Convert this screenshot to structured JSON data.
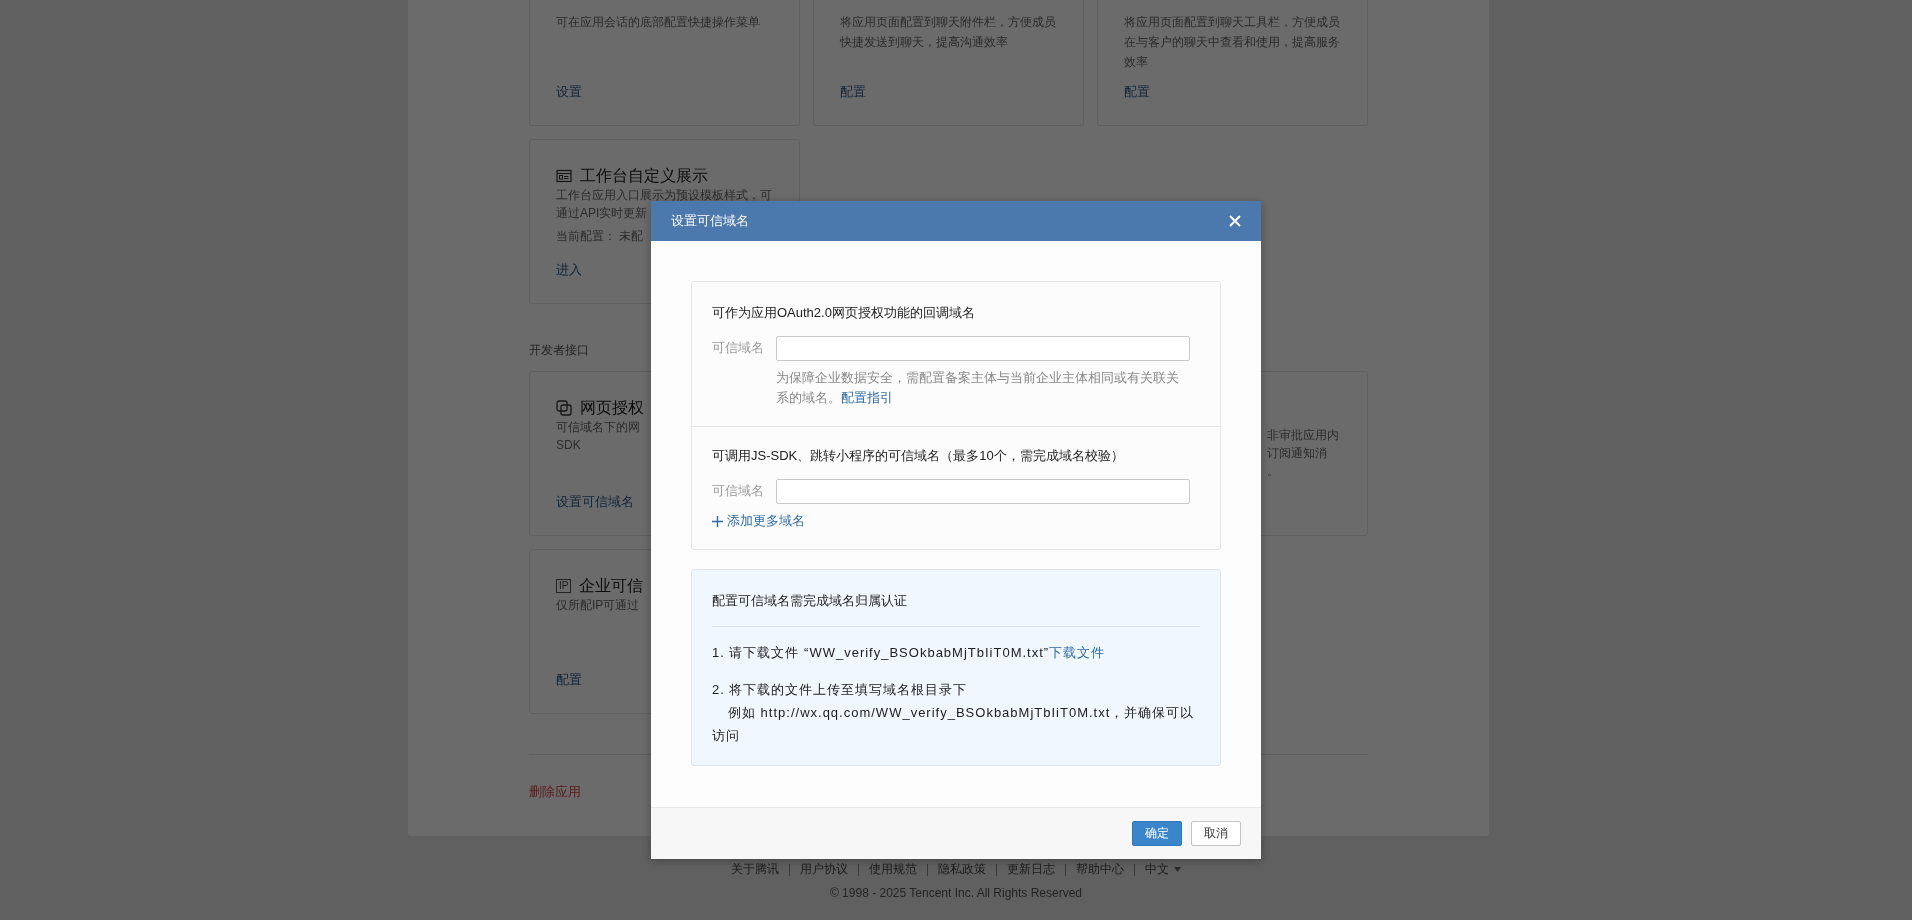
{
  "page": {
    "sections": [
      {
        "cards": [
          {
            "kind": "card",
            "lines": [
              "可在应用会话的底部配置快捷操作菜单"
            ],
            "link": "设置"
          },
          {
            "kind": "card",
            "lines": [
              "将应用页面配置到聊天附件栏，方便成员",
              "快捷发送到聊天，提高沟通效率"
            ],
            "link": "配置"
          },
          {
            "kind": "card",
            "lines": [
              "将应用页面配置到聊天工具栏，方便成员",
              "在与客户的聊天中查看和使用，提高服务",
              "效率"
            ],
            "link": "配置"
          },
          {
            "kind": "card",
            "title": "工作台自定义展示",
            "lines": [
              "工作台应用入口展示为预设模板样式，可",
              "通过API实时更新"
            ],
            "status": "当前配置： 未配",
            "link": "进入"
          }
        ]
      },
      {
        "label": "开发者接口",
        "cards": [
          {
            "kind": "card",
            "title": "网页授权",
            "lines": [
              "可信域名下的网",
              "SDK"
            ],
            "link": "设置可信域名"
          },
          {
            "kind": "clipped",
            "lines": [
              "非审批应用内",
              "订阅通知消",
              "。"
            ]
          },
          {
            "kind": "card",
            "tag": "IP",
            "title": "企业可信",
            "lines": [
              "仅所配IP可通过"
            ],
            "link": "配置"
          }
        ]
      }
    ],
    "delete_link": "删除应用"
  },
  "modal": {
    "title": "设置可信域名",
    "sections": [
      {
        "heading": "可作为应用OAuth2.0网页授权功能的回调域名",
        "field_label": "可信域名",
        "note": "为保障企业数据安全，需配置备案主体与当前企业主体相同或有关联关系的域名。",
        "note_link": "配置指引"
      },
      {
        "heading": "可调用JS-SDK、跳转小程序的可信域名（最多10个，需完成域名校验）",
        "field_label": "可信域名",
        "add_link": "添加更多域名"
      }
    ],
    "verification": {
      "title": "配置可信域名需完成域名归属认证",
      "steps": [
        {
          "text": "1. 请下载文件 “WW_verify_BSOkbabMjTbIiT0M.txt”",
          "link": "下载文件"
        },
        {
          "text": "2. 将下载的文件上传至填写域名根目录下",
          "detail": "例如 http://wx.qq.com/WW_verify_BSOkbabMjTbIiT0M.txt，并确保可以访问"
        }
      ]
    },
    "buttons": [
      {
        "label": "确定",
        "primary": true
      },
      {
        "label": "取消",
        "primary": false
      }
    ]
  },
  "footer": {
    "links": [
      "关于腾讯",
      "用户协议",
      "使用规范",
      "隐私政策",
      "更新日志",
      "帮助中心"
    ],
    "language": "中文",
    "copyright": "© 1998 - 2025 Tencent Inc. All Rights Reserved"
  }
}
